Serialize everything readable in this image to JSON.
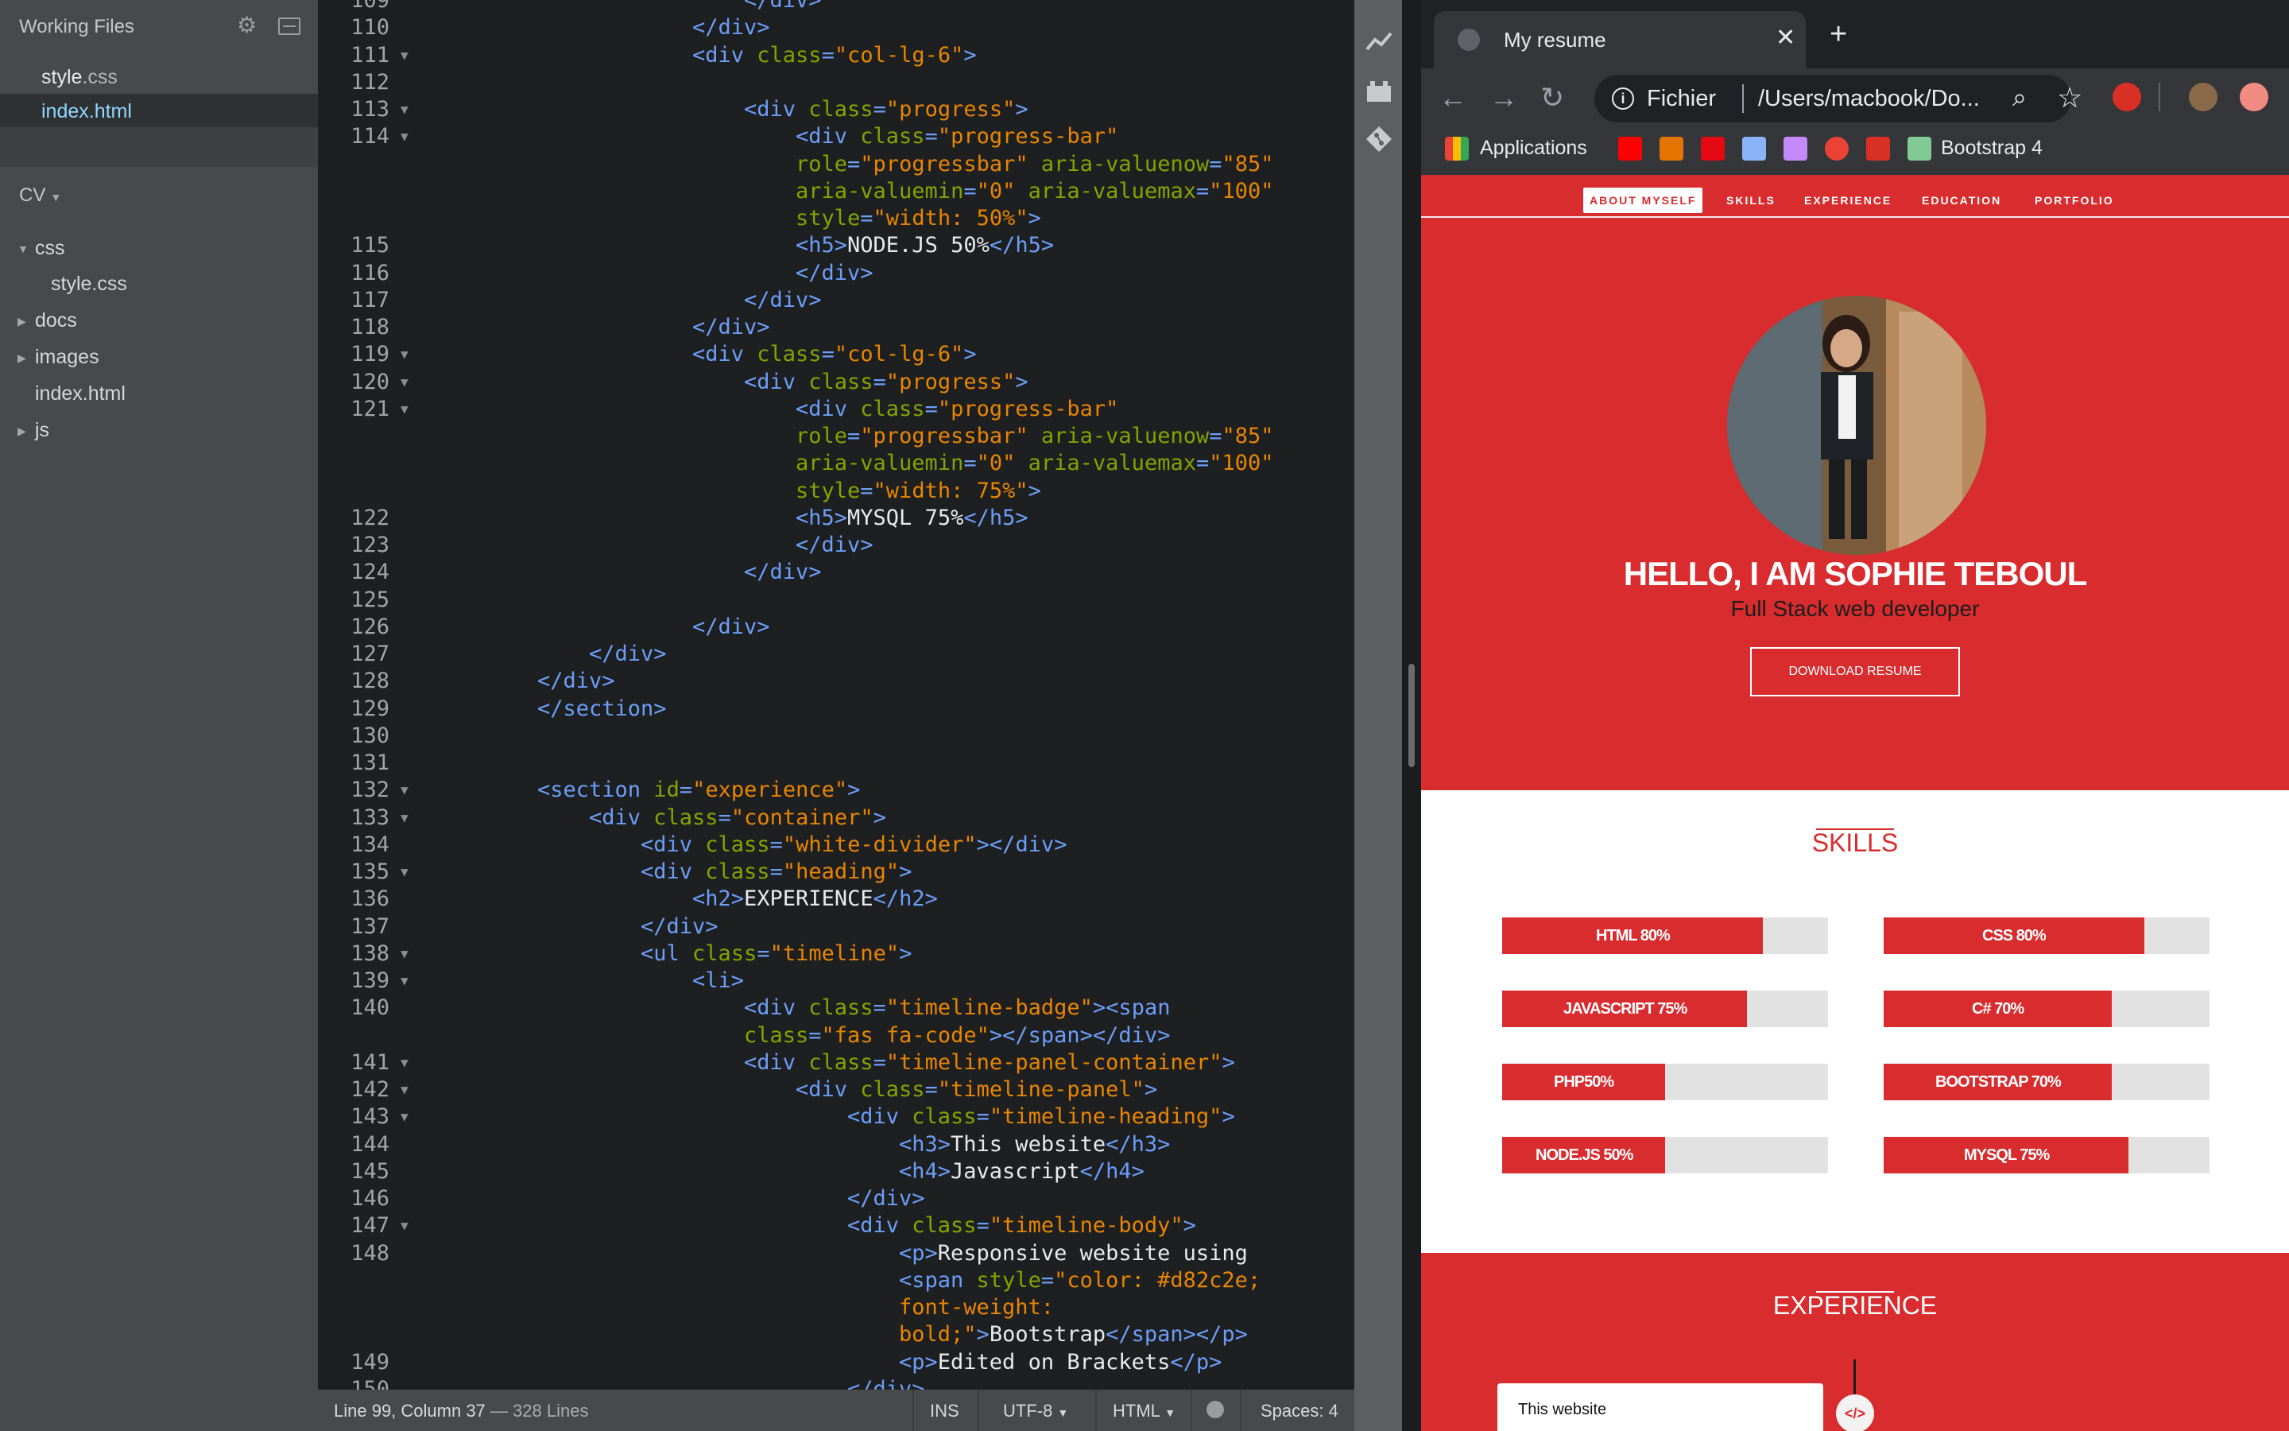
{
  "sidebar": {
    "working_files_title": "Working Files",
    "working_files": [
      {
        "name": "style",
        "ext": ".css",
        "active": false
      },
      {
        "name": "index",
        "ext": ".html",
        "active": true
      }
    ],
    "project_name": "CV",
    "tree": [
      {
        "label": "css",
        "type": "folder",
        "expanded": true,
        "depth": 0
      },
      {
        "label": "style.css",
        "type": "file",
        "depth": 1
      },
      {
        "label": "docs",
        "type": "folder",
        "expanded": false,
        "depth": 0
      },
      {
        "label": "images",
        "type": "folder",
        "expanded": false,
        "depth": 0
      },
      {
        "label": "index.html",
        "type": "file",
        "depth": 0
      },
      {
        "label": "js",
        "type": "folder",
        "expanded": false,
        "depth": 0
      }
    ]
  },
  "editor": {
    "lines": [
      {
        "n": "109",
        "fold": false,
        "tokens": [
          [
            "tag",
            "</div>"
          ]
        ],
        "indent": 24
      },
      {
        "n": "110",
        "fold": false,
        "tokens": [
          [
            "tag",
            "</div>"
          ]
        ],
        "indent": 20
      },
      {
        "n": "111",
        "fold": true,
        "tokens": [
          [
            "tag",
            "<div "
          ],
          [
            "attr",
            "class"
          ],
          [
            "tag",
            "="
          ],
          [
            "str",
            "\"col-lg-6\""
          ],
          [
            "tag",
            ">"
          ]
        ],
        "indent": 20
      },
      {
        "n": "112",
        "fold": false,
        "tokens": [],
        "indent": 0
      },
      {
        "n": "113",
        "fold": true,
        "tokens": [
          [
            "tag",
            "<div "
          ],
          [
            "attr",
            "class"
          ],
          [
            "tag",
            "="
          ],
          [
            "str",
            "\"progress\""
          ],
          [
            "tag",
            ">"
          ]
        ],
        "indent": 24
      },
      {
        "n": "114",
        "fold": true,
        "tokens": [
          [
            "tag",
            "<div "
          ],
          [
            "attr",
            "class"
          ],
          [
            "tag",
            "="
          ],
          [
            "str",
            "\"progress-bar\""
          ]
        ],
        "indent": 28
      },
      {
        "n": "",
        "fold": false,
        "tokens": [
          [
            "attr",
            "role"
          ],
          [
            "tag",
            "="
          ],
          [
            "str",
            "\"progressbar\""
          ],
          [
            "tag",
            " "
          ],
          [
            "attr",
            "aria-valuenow"
          ],
          [
            "tag",
            "="
          ],
          [
            "str",
            "\"85\""
          ]
        ],
        "indent": 28
      },
      {
        "n": "",
        "fold": false,
        "tokens": [
          [
            "attr",
            "aria-valuemin"
          ],
          [
            "tag",
            "="
          ],
          [
            "str",
            "\"0\""
          ],
          [
            "tag",
            " "
          ],
          [
            "attr",
            "aria-valuemax"
          ],
          [
            "tag",
            "="
          ],
          [
            "str",
            "\"100\""
          ]
        ],
        "indent": 28
      },
      {
        "n": "",
        "fold": false,
        "tokens": [
          [
            "attr",
            "style"
          ],
          [
            "tag",
            "="
          ],
          [
            "str",
            "\"width: 50%\""
          ],
          [
            "tag",
            ">"
          ]
        ],
        "indent": 28
      },
      {
        "n": "115",
        "fold": false,
        "tokens": [
          [
            "tag",
            "<h5>"
          ],
          [
            "txt",
            "NODE.JS 50%"
          ],
          [
            "tag",
            "</h5>"
          ]
        ],
        "indent": 28
      },
      {
        "n": "116",
        "fold": false,
        "tokens": [
          [
            "tag",
            "</div>"
          ]
        ],
        "indent": 28
      },
      {
        "n": "117",
        "fold": false,
        "tokens": [
          [
            "tag",
            "</div>"
          ]
        ],
        "indent": 24
      },
      {
        "n": "118",
        "fold": false,
        "tokens": [
          [
            "tag",
            "</div>"
          ]
        ],
        "indent": 20
      },
      {
        "n": "119",
        "fold": true,
        "tokens": [
          [
            "tag",
            "<div "
          ],
          [
            "attr",
            "class"
          ],
          [
            "tag",
            "="
          ],
          [
            "str",
            "\"col-lg-6\""
          ],
          [
            "tag",
            ">"
          ]
        ],
        "indent": 20
      },
      {
        "n": "120",
        "fold": true,
        "tokens": [
          [
            "tag",
            "<div "
          ],
          [
            "attr",
            "class"
          ],
          [
            "tag",
            "="
          ],
          [
            "str",
            "\"progress\""
          ],
          [
            "tag",
            ">"
          ]
        ],
        "indent": 24
      },
      {
        "n": "121",
        "fold": true,
        "tokens": [
          [
            "tag",
            "<div "
          ],
          [
            "attr",
            "class"
          ],
          [
            "tag",
            "="
          ],
          [
            "str",
            "\"progress-bar\""
          ]
        ],
        "indent": 28
      },
      {
        "n": "",
        "fold": false,
        "tokens": [
          [
            "attr",
            "role"
          ],
          [
            "tag",
            "="
          ],
          [
            "str",
            "\"progressbar\""
          ],
          [
            "tag",
            " "
          ],
          [
            "attr",
            "aria-valuenow"
          ],
          [
            "tag",
            "="
          ],
          [
            "str",
            "\"85\""
          ]
        ],
        "indent": 28
      },
      {
        "n": "",
        "fold": false,
        "tokens": [
          [
            "attr",
            "aria-valuemin"
          ],
          [
            "tag",
            "="
          ],
          [
            "str",
            "\"0\""
          ],
          [
            "tag",
            " "
          ],
          [
            "attr",
            "aria-valuemax"
          ],
          [
            "tag",
            "="
          ],
          [
            "str",
            "\"100\""
          ]
        ],
        "indent": 28
      },
      {
        "n": "",
        "fold": false,
        "tokens": [
          [
            "attr",
            "style"
          ],
          [
            "tag",
            "="
          ],
          [
            "str",
            "\"width: 75%\""
          ],
          [
            "tag",
            ">"
          ]
        ],
        "indent": 28
      },
      {
        "n": "122",
        "fold": false,
        "tokens": [
          [
            "tag",
            "<h5>"
          ],
          [
            "txt",
            "MYSQL 75%"
          ],
          [
            "tag",
            "</h5>"
          ]
        ],
        "indent": 28
      },
      {
        "n": "123",
        "fold": false,
        "tokens": [
          [
            "tag",
            "</div>"
          ]
        ],
        "indent": 28
      },
      {
        "n": "124",
        "fold": false,
        "tokens": [
          [
            "tag",
            "</div>"
          ]
        ],
        "indent": 24
      },
      {
        "n": "125",
        "fold": false,
        "tokens": [],
        "indent": 0
      },
      {
        "n": "126",
        "fold": false,
        "tokens": [
          [
            "tag",
            "</div>"
          ]
        ],
        "indent": 20
      },
      {
        "n": "127",
        "fold": false,
        "tokens": [
          [
            "tag",
            "</div>"
          ]
        ],
        "indent": 12
      },
      {
        "n": "128",
        "fold": false,
        "tokens": [
          [
            "tag",
            "</div>"
          ]
        ],
        "indent": 8
      },
      {
        "n": "129",
        "fold": false,
        "tokens": [
          [
            "tag",
            "</section>"
          ]
        ],
        "indent": 8
      },
      {
        "n": "130",
        "fold": false,
        "tokens": [],
        "indent": 0
      },
      {
        "n": "131",
        "fold": false,
        "tokens": [],
        "indent": 0
      },
      {
        "n": "132",
        "fold": true,
        "tokens": [
          [
            "tag",
            "<section "
          ],
          [
            "attr",
            "id"
          ],
          [
            "tag",
            "="
          ],
          [
            "str",
            "\"experience\""
          ],
          [
            "tag",
            ">"
          ]
        ],
        "indent": 8
      },
      {
        "n": "133",
        "fold": true,
        "tokens": [
          [
            "tag",
            "<div "
          ],
          [
            "attr",
            "class"
          ],
          [
            "tag",
            "="
          ],
          [
            "str",
            "\"container\""
          ],
          [
            "tag",
            ">"
          ]
        ],
        "indent": 12
      },
      {
        "n": "134",
        "fold": false,
        "tokens": [
          [
            "tag",
            "<div "
          ],
          [
            "attr",
            "class"
          ],
          [
            "tag",
            "="
          ],
          [
            "str",
            "\"white-divider\""
          ],
          [
            "tag",
            "></div>"
          ]
        ],
        "indent": 16
      },
      {
        "n": "135",
        "fold": true,
        "tokens": [
          [
            "tag",
            "<div "
          ],
          [
            "attr",
            "class"
          ],
          [
            "tag",
            "="
          ],
          [
            "str",
            "\"heading\""
          ],
          [
            "tag",
            ">"
          ]
        ],
        "indent": 16
      },
      {
        "n": "136",
        "fold": false,
        "tokens": [
          [
            "tag",
            "<h2>"
          ],
          [
            "txt",
            "EXPERIENCE"
          ],
          [
            "tag",
            "</h2>"
          ]
        ],
        "indent": 20
      },
      {
        "n": "137",
        "fold": false,
        "tokens": [
          [
            "tag",
            "</div>"
          ]
        ],
        "indent": 16
      },
      {
        "n": "138",
        "fold": true,
        "tokens": [
          [
            "tag",
            "<ul "
          ],
          [
            "attr",
            "class"
          ],
          [
            "tag",
            "="
          ],
          [
            "str",
            "\"timeline\""
          ],
          [
            "tag",
            ">"
          ]
        ],
        "indent": 16
      },
      {
        "n": "139",
        "fold": true,
        "tokens": [
          [
            "tag",
            "<li>"
          ]
        ],
        "indent": 20
      },
      {
        "n": "140",
        "fold": false,
        "tokens": [
          [
            "tag",
            "<div "
          ],
          [
            "attr",
            "class"
          ],
          [
            "tag",
            "="
          ],
          [
            "str",
            "\"timeline-badge\""
          ],
          [
            "tag",
            "><span"
          ]
        ],
        "indent": 24
      },
      {
        "n": "",
        "fold": false,
        "tokens": [
          [
            "attr",
            "class"
          ],
          [
            "tag",
            "="
          ],
          [
            "str",
            "\"fas fa-code\""
          ],
          [
            "tag",
            "></span></div>"
          ]
        ],
        "indent": 24
      },
      {
        "n": "141",
        "fold": true,
        "tokens": [
          [
            "tag",
            "<div "
          ],
          [
            "attr",
            "class"
          ],
          [
            "tag",
            "="
          ],
          [
            "str",
            "\"timeline-panel-container\""
          ],
          [
            "tag",
            ">"
          ]
        ],
        "indent": 24
      },
      {
        "n": "142",
        "fold": true,
        "tokens": [
          [
            "tag",
            "<div "
          ],
          [
            "attr",
            "class"
          ],
          [
            "tag",
            "="
          ],
          [
            "str",
            "\"timeline-panel\""
          ],
          [
            "tag",
            ">"
          ]
        ],
        "indent": 28
      },
      {
        "n": "143",
        "fold": true,
        "tokens": [
          [
            "tag",
            "<div "
          ],
          [
            "attr",
            "class"
          ],
          [
            "tag",
            "="
          ],
          [
            "str",
            "\"timeline-heading\""
          ],
          [
            "tag",
            ">"
          ]
        ],
        "indent": 32
      },
      {
        "n": "144",
        "fold": false,
        "tokens": [
          [
            "tag",
            "<h3>"
          ],
          [
            "txt",
            "This website"
          ],
          [
            "tag",
            "</h3>"
          ]
        ],
        "indent": 36
      },
      {
        "n": "145",
        "fold": false,
        "tokens": [
          [
            "tag",
            "<h4>"
          ],
          [
            "txt",
            "Javascript"
          ],
          [
            "tag",
            "</h4>"
          ]
        ],
        "indent": 36
      },
      {
        "n": "146",
        "fold": false,
        "tokens": [
          [
            "tag",
            "</div>"
          ]
        ],
        "indent": 32
      },
      {
        "n": "147",
        "fold": true,
        "tokens": [
          [
            "tag",
            "<div "
          ],
          [
            "attr",
            "class"
          ],
          [
            "tag",
            "="
          ],
          [
            "str",
            "\"timeline-body\""
          ],
          [
            "tag",
            ">"
          ]
        ],
        "indent": 32
      },
      {
        "n": "148",
        "fold": false,
        "tokens": [
          [
            "tag",
            "<p>"
          ],
          [
            "txt",
            "Responsive website using"
          ]
        ],
        "indent": 36
      },
      {
        "n": "",
        "fold": false,
        "tokens": [
          [
            "tag",
            "<span "
          ],
          [
            "attr",
            "style"
          ],
          [
            "tag",
            "="
          ],
          [
            "str",
            "\"color: #d82c2e;"
          ]
        ],
        "indent": 36
      },
      {
        "n": "",
        "fold": false,
        "tokens": [
          [
            "str",
            "font-weight:"
          ]
        ],
        "indent": 36
      },
      {
        "n": "",
        "fold": false,
        "tokens": [
          [
            "str",
            "bold;\""
          ],
          [
            "tag",
            ">"
          ],
          [
            "txt",
            "Bootstrap"
          ],
          [
            "tag",
            "</span></p>"
          ]
        ],
        "indent": 36
      },
      {
        "n": "149",
        "fold": false,
        "tokens": [
          [
            "tag",
            "<p>"
          ],
          [
            "txt",
            "Edited on Brackets"
          ],
          [
            "tag",
            "</p>"
          ]
        ],
        "indent": 36
      },
      {
        "n": "150",
        "fold": false,
        "tokens": [
          [
            "tag",
            "</div>"
          ]
        ],
        "indent": 32
      }
    ]
  },
  "statusbar": {
    "position": "Line 99, Column 37",
    "lines": "— 328 Lines",
    "mode": "INS",
    "encoding": "UTF-8",
    "language": "HTML",
    "spaces": "Spaces: 4"
  },
  "browser": {
    "tab_title": "My resume",
    "scheme": "Fichier",
    "url": "/Users/macbook/Do...",
    "bookmarks": {
      "applications": "Applications",
      "bootstrap": "Bootstrap 4"
    },
    "page": {
      "nav": [
        "ABOUT MYSELF",
        "SKILLS",
        "EXPERIENCE",
        "EDUCATION",
        "PORTFOLIO"
      ],
      "hero_title": "HELLO, I AM SOPHIE TEBOUL",
      "hero_subtitle": "Full Stack web developer",
      "download_label": "DOWNLOAD RESUME",
      "skills_title": "SKILLS",
      "skills": [
        {
          "label": "HTML 80%",
          "percent": 80
        },
        {
          "label": "CSS 80%",
          "percent": 80
        },
        {
          "label": "JAVASCRIPT 75%",
          "percent": 75
        },
        {
          "label": "C# 70%",
          "percent": 70
        },
        {
          "label": "PHP50%",
          "percent": 50
        },
        {
          "label": "BOOTSTRAP 70%",
          "percent": 70
        },
        {
          "label": "NODE.JS 50%",
          "percent": 50
        },
        {
          "label": "MYSQL 75%",
          "percent": 75
        }
      ],
      "experience_title": "EXPERIENCE",
      "experience_card_title": "This website"
    }
  },
  "colors": {
    "brand_red": "#d82c2e",
    "editor_bg": "#1d1f21",
    "tag": "#6c9ef8",
    "attr": "#85a300",
    "string": "#e88501"
  }
}
